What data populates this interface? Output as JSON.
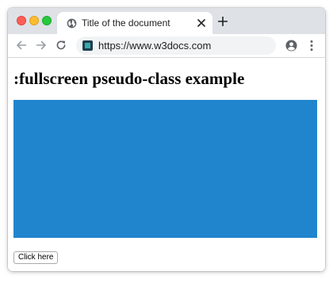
{
  "browser": {
    "tab": {
      "title": "Title of the document",
      "favicon": "globe-icon",
      "close_icon": "close-icon"
    },
    "new_tab_icon": "plus-icon",
    "toolbar": {
      "back_icon": "arrow-left-icon",
      "forward_icon": "arrow-right-icon",
      "reload_icon": "reload-icon",
      "site_icon": "w3docs-site-icon",
      "url": "https://www.w3docs.com",
      "profile_icon": "account-circle-icon",
      "menu_icon": "kebab-menu-icon"
    },
    "colors": {
      "titlebar": "#dee1e6",
      "traffic_close": "#fe5f57",
      "traffic_minimize": "#febc2e",
      "traffic_zoom": "#28c840"
    }
  },
  "page": {
    "heading": ":fullscreen pseudo-class example",
    "box_color": "#2185cd",
    "button_label": "Click here"
  }
}
